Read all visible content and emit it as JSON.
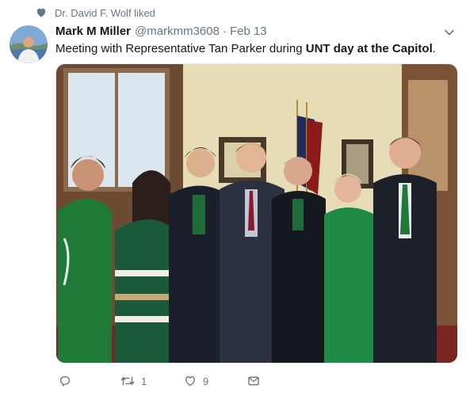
{
  "context": {
    "icon": "heart-icon",
    "text": "Dr. David F. Wolf liked"
  },
  "tweet": {
    "author_name": "Mark M Miller",
    "handle": "@markmm3608",
    "separator": "·",
    "date": "Feb 13",
    "text_before": "Meeting with Representative Tan Parker during ",
    "text_bold": "UNT day at the Capitol",
    "text_after": "."
  },
  "actions": {
    "reply": {
      "icon": "reply-icon",
      "count": ""
    },
    "retweet": {
      "icon": "retweet-icon",
      "count": "1"
    },
    "like": {
      "icon": "heart-outline-icon",
      "count": "9"
    },
    "dm": {
      "icon": "envelope-icon",
      "count": ""
    }
  },
  "colors": {
    "primary_text": "#14171a",
    "secondary_text": "#657786",
    "unt_green": "#0b7a3e"
  }
}
